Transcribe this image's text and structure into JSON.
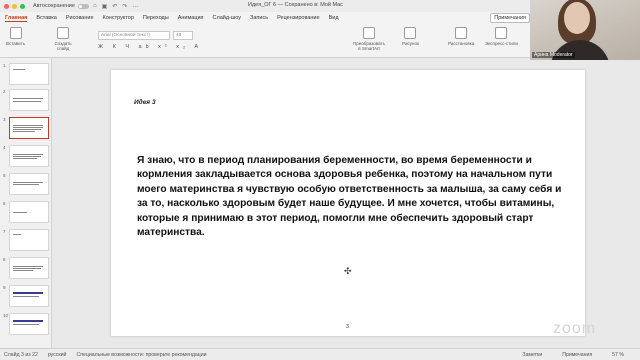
{
  "titlebar": {
    "autosave_label": "Автосохранение",
    "doc_title": "Идея_ОГ 6 — Сохранено в: Мой Mac",
    "window_buttons": [
      {
        "color": "#ff5f57"
      },
      {
        "color": "#febc2e"
      },
      {
        "color": "#28c840"
      }
    ]
  },
  "tabs": [
    "Главная",
    "Вставка",
    "Рисование",
    "Конструктор",
    "Переходы",
    "Анимация",
    "Слайд-шоу",
    "Запись",
    "Рецензирование",
    "Вид"
  ],
  "share_label": "Примечания",
  "ribbon": {
    "paste": "Вставить",
    "new_slide": "Создать слайд",
    "font_name": "Arial (Основной текст)",
    "font_size": "48",
    "format_row": "Ж К Ч ab x² x₂ A",
    "convert": "Преобразовать в SmartArt",
    "picture": "Рисунок",
    "layout": "Расстановка",
    "express": "Экспресс-стили"
  },
  "camera": {
    "name": "Арина Moderator"
  },
  "slides": {
    "numbers": [
      "1",
      "2",
      "3",
      "4",
      "5",
      "6",
      "7",
      "8",
      "9",
      "10",
      "11"
    ],
    "selected_index": 3
  },
  "slide": {
    "idea_label": "Идея 3",
    "body": "Я  знаю, что в период планирования беременности, во время беременности и кормления закладывается основа здоровья ребенка, поэтому на начальном пути моего материнства я чувствую особую ответственность за малыша, за саму себя и за то, насколько здоровым будет наше будущее. И мне хочется, чтобы витамины, которые я принимаю в этот период, помогли мне обеспечить здоровый старт материнства.",
    "page_number": "3"
  },
  "watermark": "zoom",
  "status": {
    "slide_info": "Слайд 3 из 22",
    "language": "русский",
    "accessibility": "Специальные возможности: проверьте рекомендации",
    "notes": "Заметки",
    "comments": "Примечания",
    "zoom": "57 %"
  }
}
